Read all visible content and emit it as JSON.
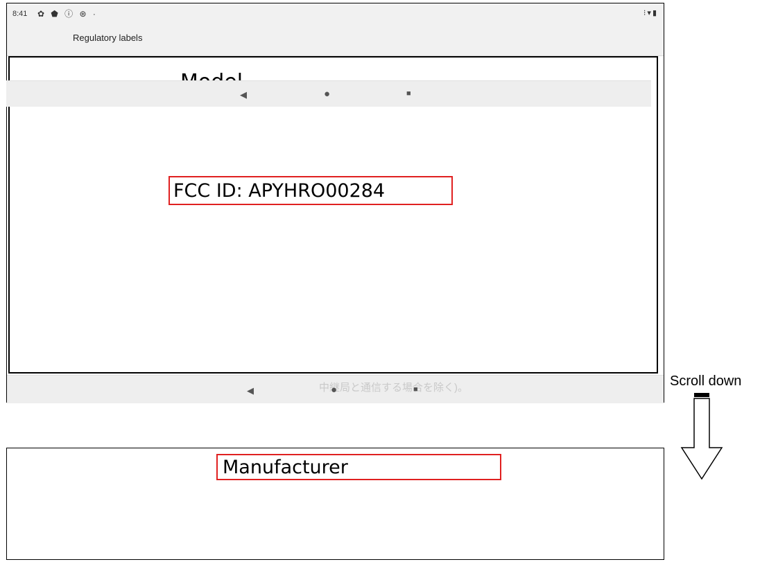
{
  "status_bar": {
    "time": "8:41",
    "left_icons": "✿ ⬟ ⓘ ⊛ ·",
    "right_icons": "⁝▾▮"
  },
  "app_bar": {
    "title": "Regulatory labels"
  },
  "content": {
    "model_label": "Model",
    "fcc_id": "FCC ID: APYHRO00284"
  },
  "nav_bar": {
    "overlay_text": "中継局と通信する場合を除く)。",
    "back_glyph": "◀",
    "home_glyph": "●",
    "recents_glyph": "■"
  },
  "scroll_hint": {
    "label": "Scroll down"
  },
  "second_screen": {
    "manufacturer_label": "Manufacturer"
  },
  "colors": {
    "highlight": "#e02020",
    "bar_background": "#f1f1f1"
  }
}
